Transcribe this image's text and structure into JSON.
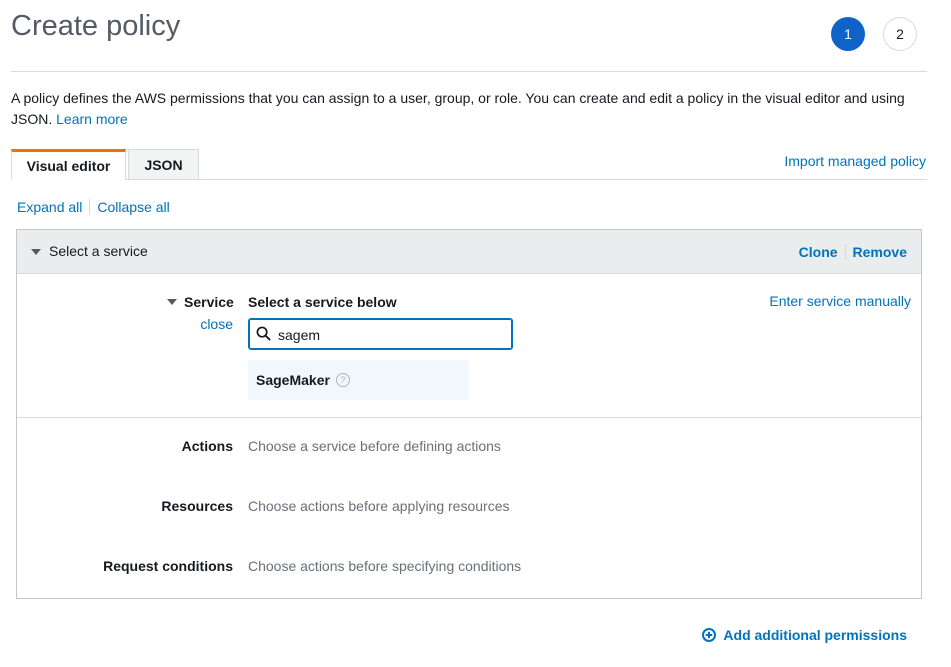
{
  "page": {
    "title": "Create policy"
  },
  "steps": [
    "1",
    "2"
  ],
  "description": {
    "text": "A policy defines the AWS permissions that you can assign to a user, group, or role. You can create and edit a policy in the visual editor and using JSON.",
    "learn_more": "Learn more"
  },
  "tabs": [
    {
      "label": "Visual editor",
      "active": true
    },
    {
      "label": "JSON",
      "active": false
    }
  ],
  "import_managed_policy": "Import managed policy",
  "expand_all": "Expand all",
  "collapse_all": "Collapse all",
  "statement": {
    "header": "Select a service",
    "clone": "Clone",
    "remove": "Remove",
    "service": {
      "label": "Service",
      "close": "close",
      "heading": "Select a service below",
      "enter_manually": "Enter service manually",
      "search_value": "sagem",
      "result": "SageMaker",
      "help_glyph": "?"
    },
    "rows": [
      {
        "label": "Actions",
        "value": "Choose a service before defining actions"
      },
      {
        "label": "Resources",
        "value": "Choose actions before applying resources"
      },
      {
        "label": "Request conditions",
        "value": "Choose actions before specifying conditions"
      }
    ]
  },
  "add_permissions": "Add additional permissions",
  "colors": {
    "accent": "#0073bb",
    "step_active": "#0f62c7",
    "tab_active_border": "#ec7211"
  }
}
